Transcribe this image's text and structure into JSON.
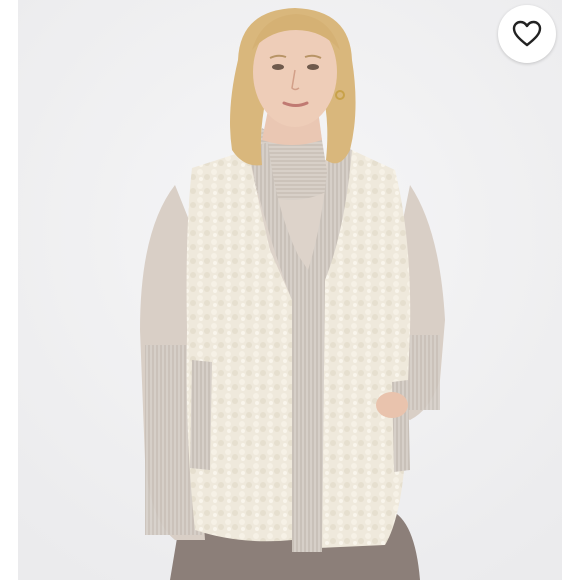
{
  "listing": {
    "photo_subject": "product-photo",
    "favorite_icon": "heart-outline-icon"
  },
  "colors": {
    "page_bg": "#ffffff",
    "studio_bg": "#f1f1f2",
    "sherpa": "#efe9dc",
    "sweater": "#d9cfc6",
    "rib_trim": "#cfc7c0",
    "hair": "#d9b77c",
    "skin": "#eecdb8",
    "pants": "#8c7f79",
    "heart_stroke": "#222222"
  }
}
